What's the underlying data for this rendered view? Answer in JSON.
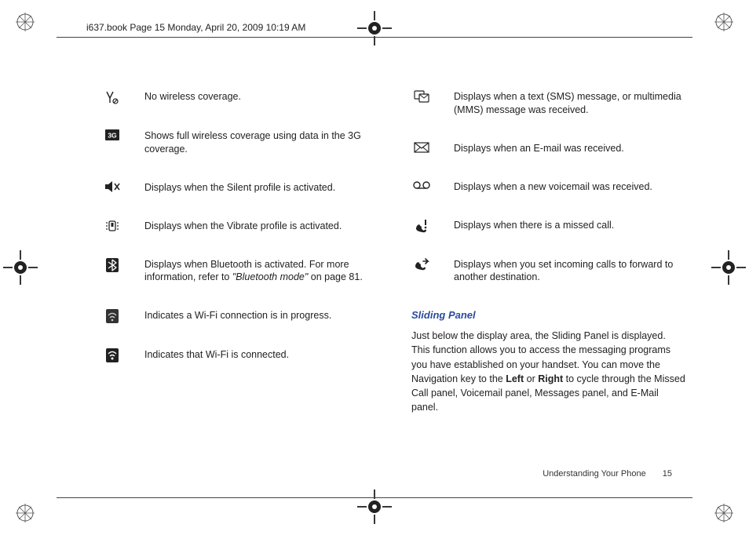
{
  "header": {
    "runningHead": "i637.book  Page 15  Monday, April 20, 2009  10:19 AM"
  },
  "leftColumn": [
    {
      "icon": "antenna-no-signal-icon",
      "text": "No wireless coverage."
    },
    {
      "icon": "badge-3g-icon",
      "text": "Shows full wireless coverage using data in the 3G coverage."
    },
    {
      "icon": "speaker-mute-icon",
      "text": "Displays when the Silent profile is activated."
    },
    {
      "icon": "vibrate-icon",
      "text": "Displays when the Vibrate profile is activated."
    },
    {
      "icon": "bluetooth-icon",
      "text_pre": "Displays when Bluetooth is activated. For more information, refer to ",
      "ref_italic": "\"Bluetooth mode\"",
      "text_post": " on page 81."
    },
    {
      "icon": "wifi-progress-icon",
      "text": "Indicates a Wi-Fi connection is in progress."
    },
    {
      "icon": "wifi-connected-icon",
      "text": "Indicates that Wi-Fi is connected."
    }
  ],
  "rightColumn": [
    {
      "icon": "sms-message-icon",
      "text": "Displays when a text (SMS) message, or multimedia (MMS) message was received."
    },
    {
      "icon": "envelope-icon",
      "text": "Displays when an E-mail was received."
    },
    {
      "icon": "voicemail-icon",
      "text": "Displays when a new voicemail was received."
    },
    {
      "icon": "missed-call-icon",
      "text": "Displays when there is a missed call."
    },
    {
      "icon": "call-forward-icon",
      "text": "Displays when you set incoming calls to forward to another destination."
    }
  ],
  "section": {
    "heading": "Sliding Panel",
    "para_pre": "Just below the display area, the Sliding Panel is displayed. This function allows you to access the messaging programs you have established on your handset. You can move the Navigation key to the ",
    "bold1": "Left",
    "mid": " or ",
    "bold2": "Right",
    "para_post": " to cycle through the Missed Call panel, Voicemail panel, Messages panel, and E-Mail panel."
  },
  "footer": {
    "section": "Understanding Your Phone",
    "page": "15"
  }
}
